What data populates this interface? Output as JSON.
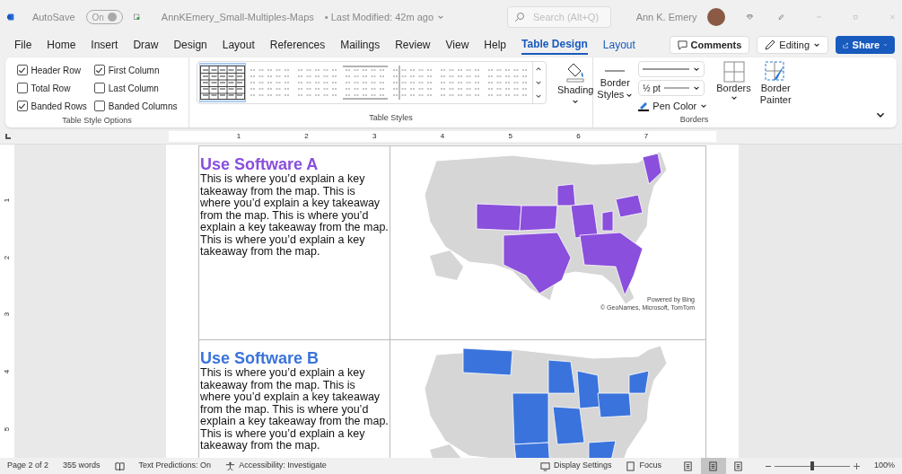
{
  "title_bar": {
    "autosave_label": "AutoSave",
    "autosave_toggle": {
      "label": "On",
      "on": true
    },
    "document_title": "AnnKEmery_Small-Multiples-Maps",
    "modified": "• Last Modified: 42m ago",
    "search": {
      "placeholder": "Search (Alt+Q)"
    },
    "user_name": "Ann K. Emery"
  },
  "menu_tabs": [
    {
      "label": "File",
      "selected": false,
      "contextual": false
    },
    {
      "label": "Home",
      "selected": false,
      "contextual": false
    },
    {
      "label": "Insert",
      "selected": false,
      "contextual": false
    },
    {
      "label": "Draw",
      "selected": false,
      "contextual": false
    },
    {
      "label": "Design",
      "selected": false,
      "contextual": false
    },
    {
      "label": "Layout",
      "selected": false,
      "contextual": false
    },
    {
      "label": "References",
      "selected": false,
      "contextual": false
    },
    {
      "label": "Mailings",
      "selected": false,
      "contextual": false
    },
    {
      "label": "Review",
      "selected": false,
      "contextual": false
    },
    {
      "label": "View",
      "selected": false,
      "contextual": false
    },
    {
      "label": "Help",
      "selected": false,
      "contextual": false
    },
    {
      "label": "Table Design",
      "selected": true,
      "contextual": true
    },
    {
      "label": "Layout",
      "selected": false,
      "contextual": true
    }
  ],
  "header_buttons": {
    "comments": "Comments",
    "editing": "Editing",
    "share": "Share"
  },
  "ribbon": {
    "style_options": {
      "label": "Table Style Options",
      "options": [
        {
          "label": "Header Row",
          "checked": true
        },
        {
          "label": "Total Row",
          "checked": false
        },
        {
          "label": "Banded Rows",
          "checked": true
        },
        {
          "label": "First Column",
          "checked": true
        },
        {
          "label": "Last Column",
          "checked": false
        },
        {
          "label": "Banded Columns",
          "checked": false
        }
      ]
    },
    "table_styles": {
      "label": "Table Styles",
      "styles": [
        {
          "selected": true
        },
        {
          "selected": false
        },
        {
          "selected": false
        },
        {
          "selected": false
        },
        {
          "selected": false
        },
        {
          "selected": false
        },
        {
          "selected": false
        }
      ],
      "shading": "Shading"
    },
    "borders": {
      "label": "Borders",
      "border_styles": [
        "Border",
        "Styles"
      ],
      "weight": "½ pt",
      "pen_color": "Pen Color",
      "borders_button": "Borders",
      "border_painter": [
        "Border",
        "Painter"
      ]
    }
  },
  "ruler": {
    "marks": [
      "1",
      "2",
      "3",
      "4",
      "5",
      "6",
      "7"
    ],
    "vertical_marks": [
      "1",
      "2",
      "3",
      "4",
      "5"
    ]
  },
  "document": {
    "rows": [
      {
        "heading": "Use Software A",
        "color": "#8a4fdc",
        "body": "This is where you’d explain a key takeaway from the map. This is where you’d explain a key takeaway from the map. This is where you’d explain a key takeaway from the map. This is where you’d explain a key takeaway from the map.",
        "credits": [
          "Powered by Bing",
          "© GeoNames, Microsoft, TomTom"
        ]
      },
      {
        "heading": "Use Software B",
        "color": "#3a73dc",
        "body": "This is where you’d explain a key takeaway from the map. This is where you’d explain a key takeaway from the map. This is where you’d explain a key takeaway from the map. This is where you’d explain a key takeaway from the map.",
        "credits": []
      }
    ]
  },
  "status_bar": {
    "page": "Page 2 of 2",
    "words": "355 words",
    "predictions": "Text Predictions: On",
    "accessibility": "Accessibility: Investigate",
    "display_settings": "Display Settings",
    "focus": "Focus",
    "views": [
      {
        "selected": false
      },
      {
        "selected": true
      },
      {
        "selected": false
      }
    ],
    "zoom": {
      "level": 0.5,
      "reading": "100%"
    }
  }
}
